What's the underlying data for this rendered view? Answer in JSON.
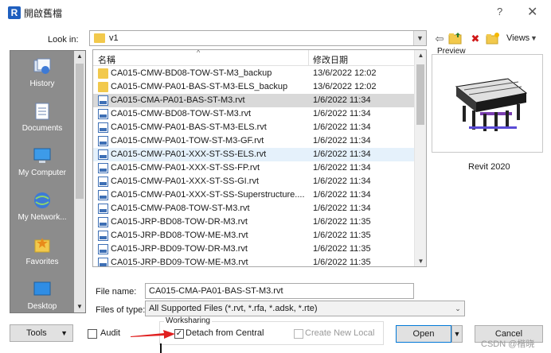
{
  "window": {
    "title": "開啟舊檔",
    "app_icon_letter": "R",
    "help_glyph": "?",
    "close_glyph": "✕"
  },
  "lookin": {
    "label": "Look in:",
    "value": "v1",
    "views_label": "Views"
  },
  "places": [
    {
      "label": "History",
      "icon": "history-icon"
    },
    {
      "label": "Documents",
      "icon": "documents-icon"
    },
    {
      "label": "My Computer",
      "icon": "computer-icon"
    },
    {
      "label": "My Network...",
      "icon": "network-icon"
    },
    {
      "label": "Favorites",
      "icon": "favorites-icon"
    },
    {
      "label": "Desktop",
      "icon": "desktop-icon"
    }
  ],
  "filelist": {
    "col_name": "名稱",
    "col_date": "修改日期",
    "rows": [
      {
        "type": "folder",
        "name": "CA015-CMW-BD08-TOW-ST-M3_backup",
        "date": "13/6/2022 12:02",
        "state": ""
      },
      {
        "type": "folder",
        "name": "CA015-CMW-PA01-BAS-ST-M3-ELS_backup",
        "date": "13/6/2022 12:02",
        "state": ""
      },
      {
        "type": "rvt",
        "name": "CA015-CMA-PA01-BAS-ST-M3.rvt",
        "date": "1/6/2022 11:34",
        "state": "selected"
      },
      {
        "type": "rvt",
        "name": "CA015-CMW-BD08-TOW-ST-M3.rvt",
        "date": "1/6/2022 11:34",
        "state": ""
      },
      {
        "type": "rvt",
        "name": "CA015-CMW-PA01-BAS-ST-M3-ELS.rvt",
        "date": "1/6/2022 11:34",
        "state": ""
      },
      {
        "type": "rvt",
        "name": "CA015-CMW-PA01-TOW-ST-M3-GF.rvt",
        "date": "1/6/2022 11:34",
        "state": ""
      },
      {
        "type": "rvt",
        "name": "CA015-CMW-PA01-XXX-ST-SS-ELS.rvt",
        "date": "1/6/2022 11:34",
        "state": "hover"
      },
      {
        "type": "rvt",
        "name": "CA015-CMW-PA01-XXX-ST-SS-FP.rvt",
        "date": "1/6/2022 11:34",
        "state": ""
      },
      {
        "type": "rvt",
        "name": "CA015-CMW-PA01-XXX-ST-SS-GI.rvt",
        "date": "1/6/2022 11:34",
        "state": ""
      },
      {
        "type": "rvt",
        "name": "CA015-CMW-PA01-XXX-ST-SS-Superstructure....",
        "date": "1/6/2022 11:34",
        "state": ""
      },
      {
        "type": "rvt",
        "name": "CA015-CMW-PA08-TOW-ST-M3.rvt",
        "date": "1/6/2022 11:34",
        "state": ""
      },
      {
        "type": "rvt",
        "name": "CA015-JRP-BD08-TOW-DR-M3.rvt",
        "date": "1/6/2022 11:35",
        "state": ""
      },
      {
        "type": "rvt",
        "name": "CA015-JRP-BD08-TOW-ME-M3.rvt",
        "date": "1/6/2022 11:35",
        "state": ""
      },
      {
        "type": "rvt",
        "name": "CA015-JRP-BD09-TOW-DR-M3.rvt",
        "date": "1/6/2022 11:35",
        "state": ""
      },
      {
        "type": "rvt",
        "name": "CA015-JRP-BD09-TOW-ME-M3.rvt",
        "date": "1/6/2022 11:35",
        "state": ""
      }
    ]
  },
  "preview": {
    "label": "Preview",
    "version": "Revit 2020"
  },
  "filename": {
    "label": "File name:",
    "value": "CA015-CMA-PA01-BAS-ST-M3.rvt"
  },
  "filetype": {
    "label": "Files of type:",
    "value": "All Supported Files  (*.rvt, *.rfa, *.adsk, *.rte)"
  },
  "bottom": {
    "tools_label": "Tools",
    "audit_label": "Audit",
    "worksharing_label": "Worksharing",
    "detach_label": "Detach from Central",
    "detach_checked": true,
    "create_new_local_label": "Create New Local",
    "open_label": "Open",
    "cancel_label": "Cancel"
  },
  "watermark": "CSDN @楷晓",
  "colors": {
    "accent": "#0078d7",
    "selected_row": "#d9d9d9",
    "hover_row": "#e5f1fb",
    "annotation_arrow": "#e02020"
  }
}
